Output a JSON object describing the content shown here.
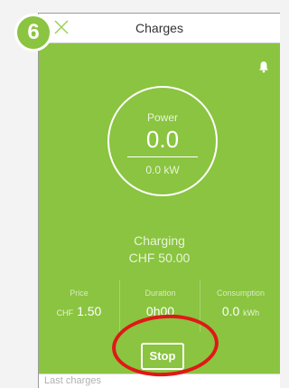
{
  "step_badge": "6",
  "header": {
    "title": "Charges"
  },
  "power": {
    "label": "Power",
    "value": "0.0",
    "kw": "0.0 kW"
  },
  "status": {
    "state": "Charging",
    "amount": "CHF 50.00"
  },
  "stats": [
    {
      "label": "Price",
      "unit_before": "CHF",
      "value": "1.50",
      "unit_after": ""
    },
    {
      "label": "Duration",
      "unit_before": "",
      "value": "0h00",
      "unit_after": ""
    },
    {
      "label": "Consumption",
      "unit_before": "",
      "value": "0.0",
      "unit_after": "kWh"
    }
  ],
  "stop_button": "Stop",
  "footer": {
    "text": "Last charges"
  },
  "colors": {
    "brand_green": "#8ac440",
    "annotation_red": "#e01818"
  },
  "icons": {
    "close": "close-icon",
    "notification": "bell-icon"
  }
}
